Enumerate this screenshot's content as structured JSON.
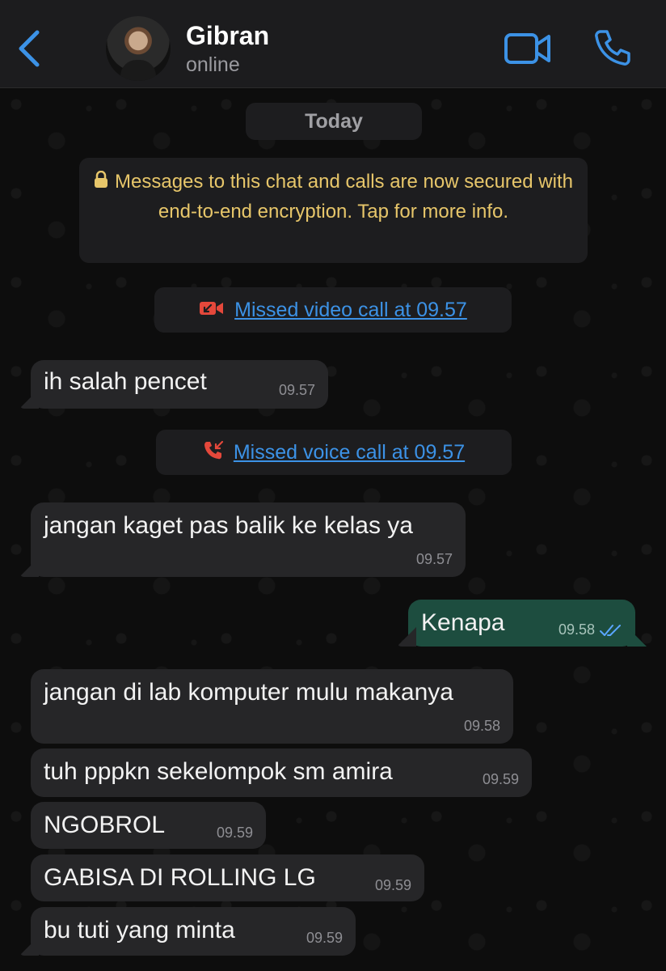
{
  "header": {
    "name": "Gibran",
    "status": "online"
  },
  "chat": {
    "date_label": "Today",
    "encryption_notice": "Messages to this chat and calls are now secured with end-to-end encryption. Tap for more info.",
    "missed_video": "Missed video call at 09.57",
    "missed_voice": "Missed voice call at 09.57",
    "messages": [
      {
        "text": "ih salah pencet",
        "time": "09.57",
        "direction": "in"
      },
      {
        "text": "jangan kaget pas balik ke kelas ya",
        "time": "09.57",
        "direction": "in"
      },
      {
        "text": "Kenapa",
        "time": "09.58",
        "direction": "out",
        "status": "read"
      },
      {
        "text": "jangan di lab komputer mulu makanya",
        "time": "09.58",
        "direction": "in"
      },
      {
        "text": "tuh pppkn sekelompok sm amira",
        "time": "09.59",
        "direction": "in"
      },
      {
        "text": "NGOBROL",
        "time": "09.59",
        "direction": "in"
      },
      {
        "text": "GABISA DI ROLLING LG",
        "time": "09.59",
        "direction": "in"
      },
      {
        "text": "bu tuti yang minta",
        "time": "09.59",
        "direction": "in"
      }
    ]
  },
  "colors": {
    "accent": "#3c92e6",
    "missed": "#e5483b",
    "notice": "#e7c66a",
    "incoming_bubble": "#262628",
    "outgoing_bubble": "#1d4d3f"
  },
  "icons": [
    "back-chevron-icon",
    "video-call-icon",
    "phone-call-icon",
    "lock-icon",
    "missed-video-call-icon",
    "missed-voice-call-icon",
    "double-check-icon"
  ]
}
